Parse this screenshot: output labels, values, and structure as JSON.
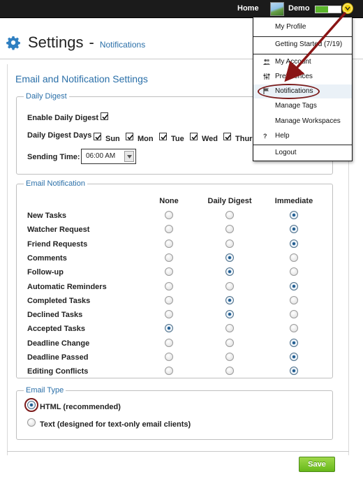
{
  "topbar": {
    "home_label": "Home",
    "user_name": "Demo",
    "progress_fraction": 0.5
  },
  "header": {
    "title": "Settings",
    "separator": "-",
    "subtitle": "Notifications"
  },
  "main": {
    "section_title": "Email and Notification Settings",
    "daily_digest": {
      "legend": "Daily Digest",
      "enable_label": "Enable Daily Digest",
      "enable_checked": true,
      "days_label": "Daily Digest Days",
      "days": [
        {
          "label": "Sun",
          "checked": true
        },
        {
          "label": "Mon",
          "checked": true
        },
        {
          "label": "Tue",
          "checked": true
        },
        {
          "label": "Wed",
          "checked": true
        },
        {
          "label": "Thur",
          "checked": true
        }
      ],
      "sending_time_label": "Sending Time:",
      "sending_time_value": "06:00 AM"
    },
    "email_notification": {
      "legend": "Email Notification",
      "columns": [
        "None",
        "Daily Digest",
        "Immediate"
      ],
      "rows": [
        {
          "label": "New Tasks",
          "selected": "Immediate"
        },
        {
          "label": "Watcher Request",
          "selected": "Immediate"
        },
        {
          "label": "Friend Requests",
          "selected": "Immediate"
        },
        {
          "label": "Comments",
          "selected": "Daily Digest"
        },
        {
          "label": "Follow-up",
          "selected": "Daily Digest"
        },
        {
          "label": "Automatic Reminders",
          "selected": "Immediate"
        },
        {
          "label": "Completed Tasks",
          "selected": "Daily Digest"
        },
        {
          "label": "Declined Tasks",
          "selected": "Daily Digest"
        },
        {
          "label": "Accepted Tasks",
          "selected": "None"
        },
        {
          "label": "Deadline Change",
          "selected": "Immediate"
        },
        {
          "label": "Deadline Passed",
          "selected": "Immediate"
        },
        {
          "label": "Editing Conflicts",
          "selected": "Immediate"
        }
      ]
    },
    "email_type": {
      "legend": "Email Type",
      "options": [
        {
          "label": "HTML (recommended)",
          "selected": true
        },
        {
          "label": "Text (designed for text-only email clients)",
          "selected": false
        }
      ]
    },
    "save_label": "Save"
  },
  "dropdown": {
    "items": [
      {
        "label": "My Profile",
        "icon": ""
      },
      {
        "label": "Getting Started (7/19)",
        "icon": ""
      },
      {
        "label": "My Account",
        "icon": "users-icon"
      },
      {
        "label": "Preferences",
        "icon": "sliders-icon"
      },
      {
        "label": "Notifications",
        "icon": "flag-icon"
      },
      {
        "label": "Manage Tags",
        "icon": ""
      },
      {
        "label": "Manage Workspaces",
        "icon": ""
      },
      {
        "label": "Help",
        "icon": "question-icon"
      },
      {
        "label": "Logout",
        "icon": ""
      }
    ]
  },
  "colors": {
    "accent_blue": "#2a6fa8",
    "highlight_ring": "#7a1a1a",
    "save_green": "#67b81a",
    "topbar": "#1b1b1b"
  }
}
